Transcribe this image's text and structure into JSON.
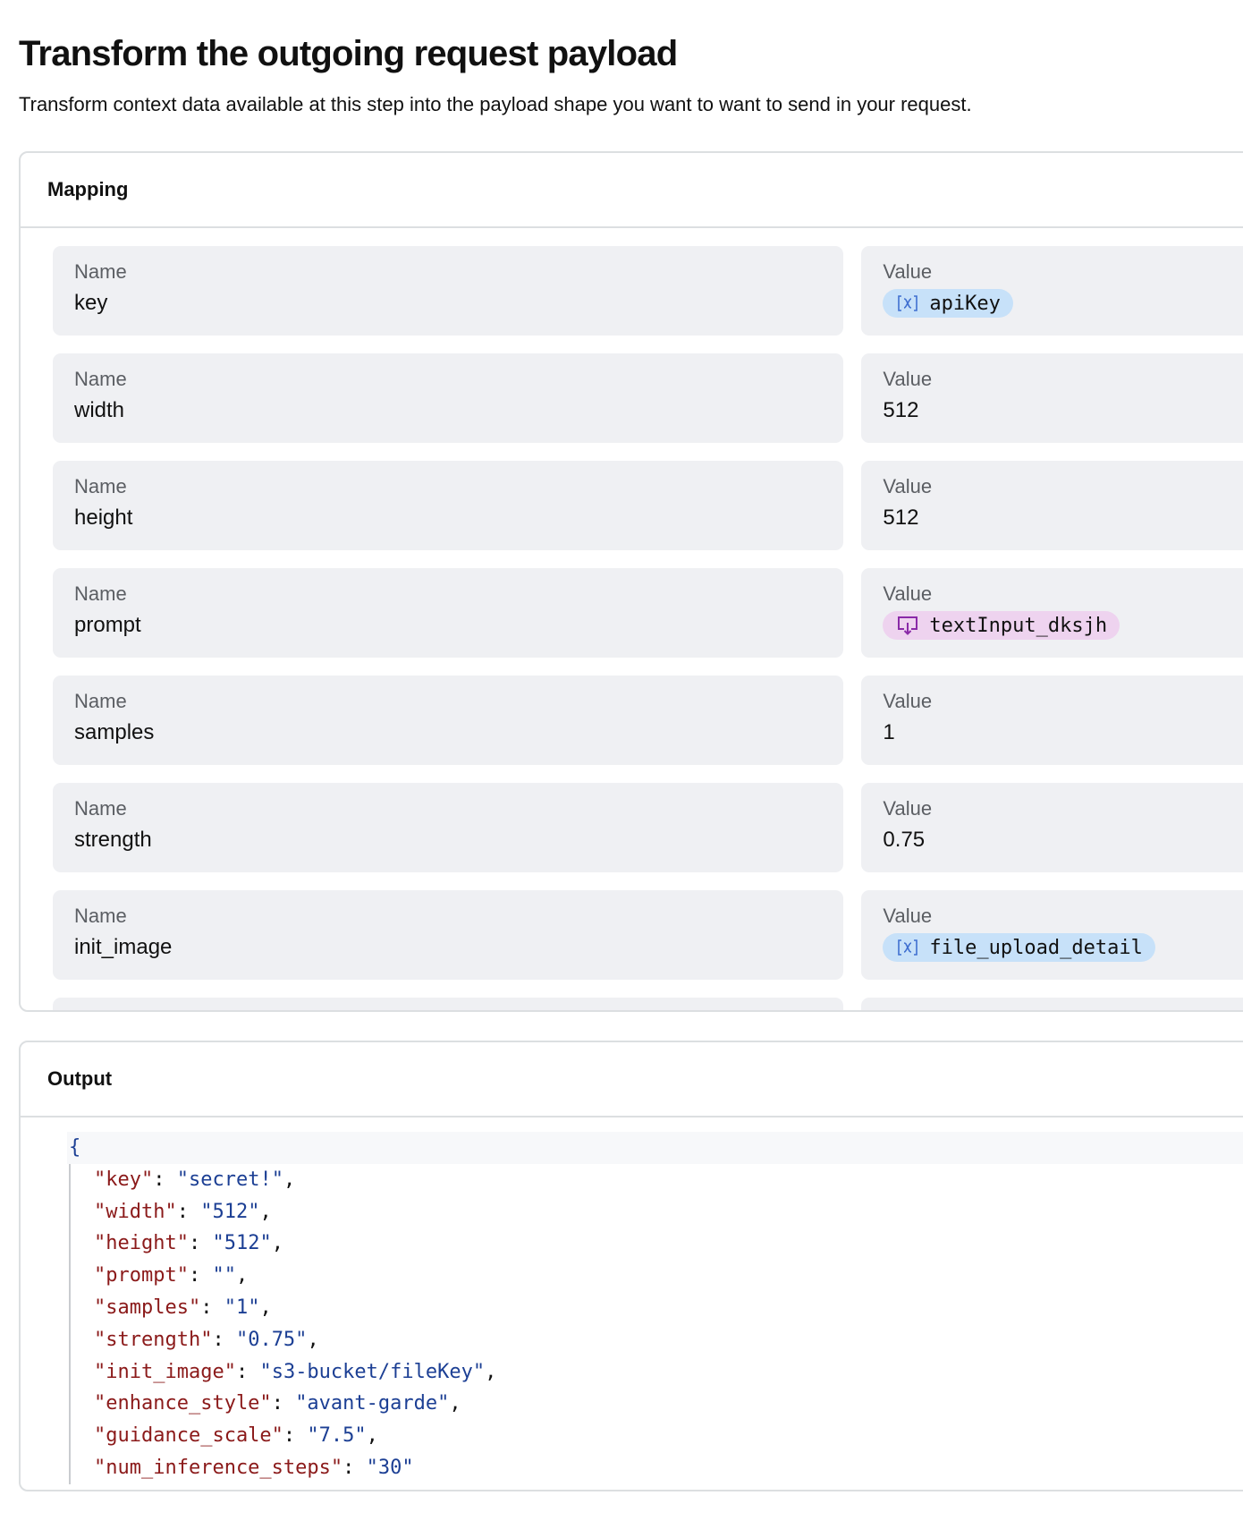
{
  "header": {
    "title": "Transform the outgoing request payload",
    "subtitle": "Transform context data available at this step into the payload shape you want to want to send in your request."
  },
  "mapping": {
    "title": "Mapping",
    "name_label": "Name",
    "value_label": "Value",
    "rows": [
      {
        "name": "key",
        "value": "apiKey",
        "value_type": "variable"
      },
      {
        "name": "width",
        "value": "512",
        "value_type": "literal"
      },
      {
        "name": "height",
        "value": "512",
        "value_type": "literal"
      },
      {
        "name": "prompt",
        "value": "textInput_dksjh",
        "value_type": "input"
      },
      {
        "name": "samples",
        "value": "1",
        "value_type": "literal"
      },
      {
        "name": "strength",
        "value": "0.75",
        "value_type": "literal"
      },
      {
        "name": "init_image",
        "value": "file_upload_detail",
        "value_type": "variable"
      }
    ]
  },
  "output": {
    "title": "Output",
    "open_brace": "{",
    "entries": [
      {
        "key": "\"key\"",
        "value": "\"secret!\"",
        "comma": ","
      },
      {
        "key": "\"width\"",
        "value": "\"512\"",
        "comma": ","
      },
      {
        "key": "\"height\"",
        "value": "\"512\"",
        "comma": ","
      },
      {
        "key": "\"prompt\"",
        "value": "\"\"",
        "comma": ","
      },
      {
        "key": "\"samples\"",
        "value": "\"1\"",
        "comma": ","
      },
      {
        "key": "\"strength\"",
        "value": "\"0.75\"",
        "comma": ","
      },
      {
        "key": "\"init_image\"",
        "value": "\"s3-bucket/fileKey\"",
        "comma": ","
      },
      {
        "key": "\"enhance_style\"",
        "value": "\"avant-garde\"",
        "comma": ","
      },
      {
        "key": "\"guidance_scale\"",
        "value": "\"7.5\"",
        "comma": ","
      },
      {
        "key": "\"num_inference_steps\"",
        "value": "\"30\"",
        "comma": ""
      }
    ]
  },
  "icons": {
    "variable": "variable-x-icon",
    "input": "text-input-icon"
  },
  "colors": {
    "variable_chip": "#c7e1f9",
    "input_chip": "#eed3ef",
    "json_key": "#8b1a1a",
    "json_string": "#1c3f94"
  }
}
